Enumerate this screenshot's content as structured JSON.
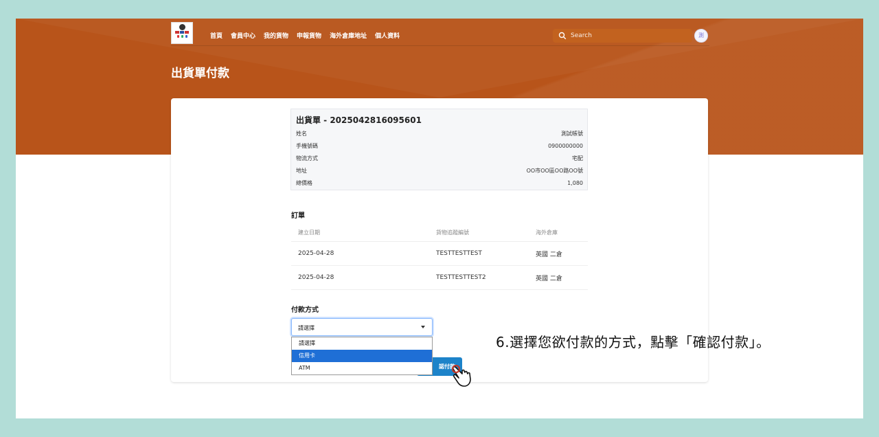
{
  "nav": {
    "logo_text": "A. Baer Bear",
    "links": [
      "首頁",
      "會員中心",
      "我的貨物",
      "申報貨物",
      "海外倉庫地址",
      "個人資料"
    ],
    "search_placeholder": "Search",
    "avatar_text": "測"
  },
  "page": {
    "title": "出貨單付款"
  },
  "shipment": {
    "title": "出貨單 - 2025042816095601",
    "fields": [
      {
        "label": "姓名",
        "value": "測試帳號"
      },
      {
        "label": "手機號碼",
        "value": "0900000000"
      },
      {
        "label": "物流方式",
        "value": "宅配"
      },
      {
        "label": "地址",
        "value": "OO市OO區OO路OO號"
      },
      {
        "label": "總價格",
        "value": "1,080"
      }
    ]
  },
  "orders": {
    "title": "訂單",
    "headers": [
      "建立日期",
      "貨物追蹤編號",
      "海外倉庫"
    ],
    "rows": [
      [
        "2025-04-28",
        "TESTTESTTEST",
        "英國 二倉"
      ],
      [
        "2025-04-28",
        "TESTTESTTEST2",
        "英國 二倉"
      ]
    ]
  },
  "payment": {
    "title": "付款方式",
    "selected": "請選擇",
    "options": [
      "請選擇",
      "信用卡",
      "ATM"
    ],
    "highlighted_option": "信用卡",
    "confirm_label_visible": "認付款"
  },
  "annotation": "6.選擇您欲付款的方式，點擊「確認付款」。",
  "colors": {
    "hero": "#b8541a",
    "accent_button": "#1d83c9",
    "selected_option": "#1f6fd6",
    "background": "#b2ddd7"
  }
}
